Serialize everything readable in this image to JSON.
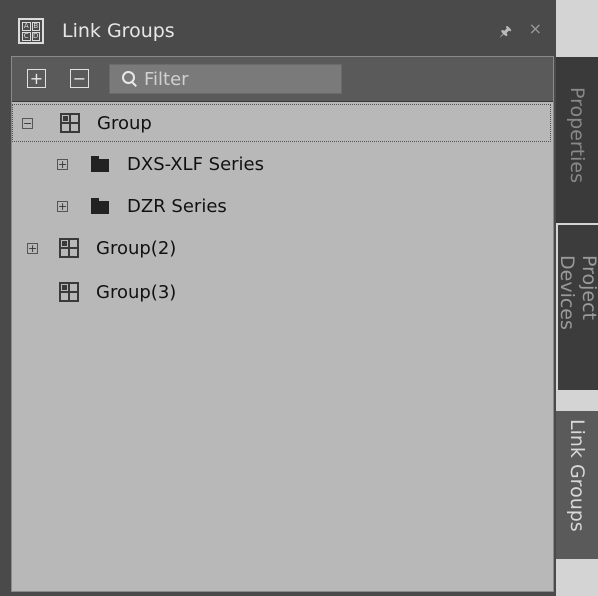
{
  "window": {
    "title": "Link Groups",
    "app_icon_letters": [
      "A",
      "B",
      "C",
      "D"
    ]
  },
  "toolbar": {
    "add_symbol": "+",
    "remove_symbol": "−",
    "filter_placeholder": "Filter",
    "filter_value": ""
  },
  "tree": [
    {
      "label": "Group",
      "expander": "⊟",
      "icon": "group-icon",
      "selected": true
    },
    {
      "label": "DXS-XLF Series",
      "expander": "⊞",
      "icon": "folder-icon"
    },
    {
      "label": "DZR Series",
      "expander": "⊞",
      "icon": "folder-icon"
    },
    {
      "label": "Group(2)",
      "expander": "⊞",
      "icon": "group-icon"
    },
    {
      "label": "Group(3)",
      "expander": "",
      "icon": "group-icon"
    }
  ],
  "side_tabs": [
    {
      "label": "Properties"
    },
    {
      "label": "Project Devices"
    },
    {
      "label": "Link Groups",
      "active": true
    }
  ]
}
